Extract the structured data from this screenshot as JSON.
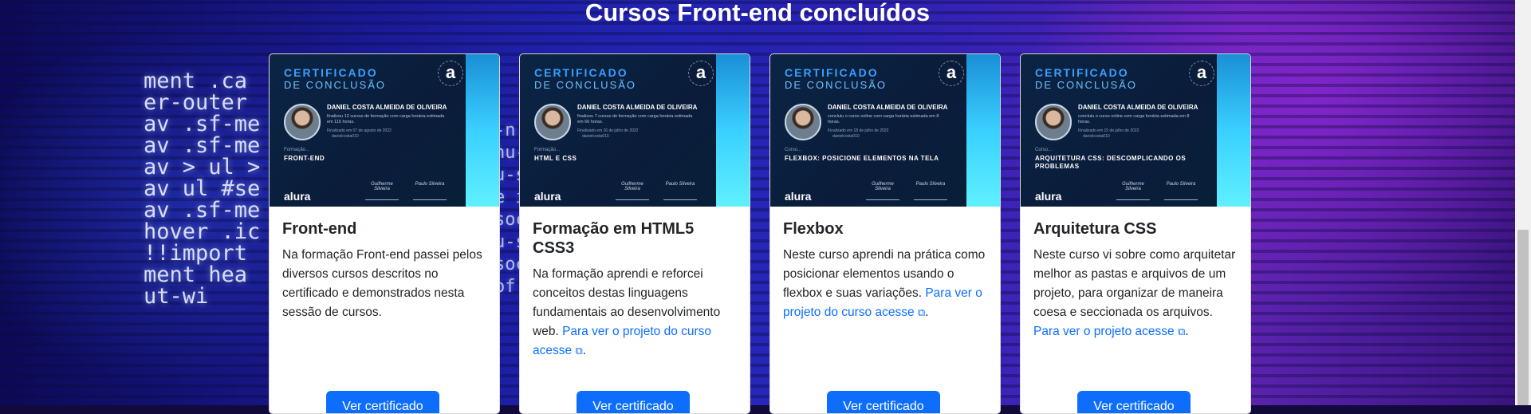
{
  "section": {
    "title": "Cursos Front-end concluídos"
  },
  "background": {
    "code_left": "ment .ca\ner-outer\nav .sf-me\nav .sf-me\nav > ul >\nav ul #se\nav .sf-me\nhover .ic\n!!import\nment hea\nut-wi",
    "code_mid": "-n\nhu-\nu-s\ne i\nsoc\nu-s\nsoc\nof"
  },
  "cards": [
    {
      "cert": {
        "heading1": "CERTIFICADO",
        "heading2": "DE CONCLUSÃO",
        "name": "DANIEL COSTA ALMEIDA DE OLIVEIRA",
        "desc": "finalizou 12 cursos de formação com carga horária estimada em 115 horas.",
        "date": "Finalizado em 07 de agosto de 2022",
        "user": "danielcosta010",
        "type_label": "Formação...",
        "course": "FRONT-END",
        "brand": "alura",
        "sig1": "Guilherme Silveira",
        "sig2": "Paulo Silveira"
      },
      "title": "Front-end",
      "text": "Na formação Front-end passei pelos diversos cursos descritos no certificado e demonstrados nesta sessão de cursos.",
      "link": "",
      "after": "",
      "button": "Ver certificado"
    },
    {
      "cert": {
        "heading1": "CERTIFICADO",
        "heading2": "DE CONCLUSÃO",
        "name": "DANIEL COSTA ALMEIDA DE OLIVEIRA",
        "desc": "finalizou 7 cursos de formação com carga horária estimada em 66 horas.",
        "date": "Finalizado em 16 de julho de 2022",
        "user": "danielcosta010",
        "type_label": "Formação...",
        "course": "HTML E CSS",
        "brand": "alura",
        "sig1": "Guilherme Silveira",
        "sig2": "Paulo Silveira"
      },
      "title": "Formação em HTML5 CSS3",
      "text": "Na formação aprendi e reforcei conceitos destas linguagens fundamentais ao desenvolvimento web. ",
      "link": "Para ver o projeto do curso acesse",
      "after": ".",
      "button": "Ver certificado"
    },
    {
      "cert": {
        "heading1": "CERTIFICADO",
        "heading2": "DE CONCLUSÃO",
        "name": "DANIEL COSTA ALMEIDA DE OLIVEIRA",
        "desc": "concluiu o curso online com carga horária estimada em 8 horas.",
        "date": "Finalizado em 18 de julho de 2022",
        "user": "danielcosta010",
        "type_label": "Curso...",
        "course": "FLEXBOX: POSICIONE ELEMENTOS NA TELA",
        "brand": "alura",
        "sig1": "Guilherme Silveira",
        "sig2": "Paulo Silveira"
      },
      "title": "Flexbox",
      "text": "Neste curso aprendi na prática como posicionar elementos usando o flexbox e suas variações. ",
      "link": "Para ver o projeto do curso acesse",
      "after": ".",
      "button": "Ver certificado"
    },
    {
      "cert": {
        "heading1": "CERTIFICADO",
        "heading2": "DE CONCLUSÃO",
        "name": "DANIEL COSTA ALMEIDA DE OLIVEIRA",
        "desc": "concluiu o curso online com carga horária estimada em 8 horas.",
        "date": "Finalizado em 15 de julho de 2022",
        "user": "danielcosta010",
        "type_label": "Curso...",
        "course": "ARQUITETURA CSS: DESCOMPLICANDO OS PROBLEMAS",
        "brand": "alura",
        "sig1": "Guilherme Silveira",
        "sig2": "Paulo Silveira"
      },
      "title": "Arquitetura CSS",
      "text": "Neste curso vi sobre como arquitetar melhor as pastas e arquivos de um projeto, para organizar de maneira coesa e seccionada os arquivos. ",
      "link": "Para ver o projeto acesse",
      "after": ".",
      "button": "Ver certificado"
    }
  ]
}
